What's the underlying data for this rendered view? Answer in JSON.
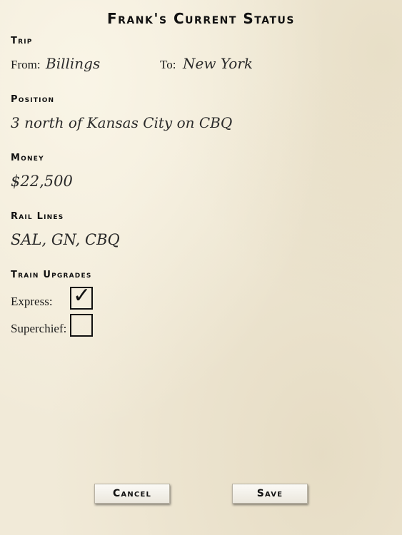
{
  "title": "Frank's Current Status",
  "trip": {
    "heading": "Trip",
    "from_label": "From:",
    "from_value": "Billings",
    "to_label": "To:",
    "to_value": "New York"
  },
  "position": {
    "heading": "Position",
    "value": "3 north of Kansas City on CBQ"
  },
  "money": {
    "heading": "Money",
    "value": "$22,500"
  },
  "rail_lines": {
    "heading": "Rail Lines",
    "value": "SAL, GN, CBQ"
  },
  "train_upgrades": {
    "heading": "Train Upgrades",
    "express_label": "Express:",
    "express_checked": true,
    "express_mark": "✓",
    "superchief_label": "Superchief:",
    "superchief_checked": false
  },
  "buttons": {
    "cancel": "Cancel",
    "save": "Save"
  }
}
